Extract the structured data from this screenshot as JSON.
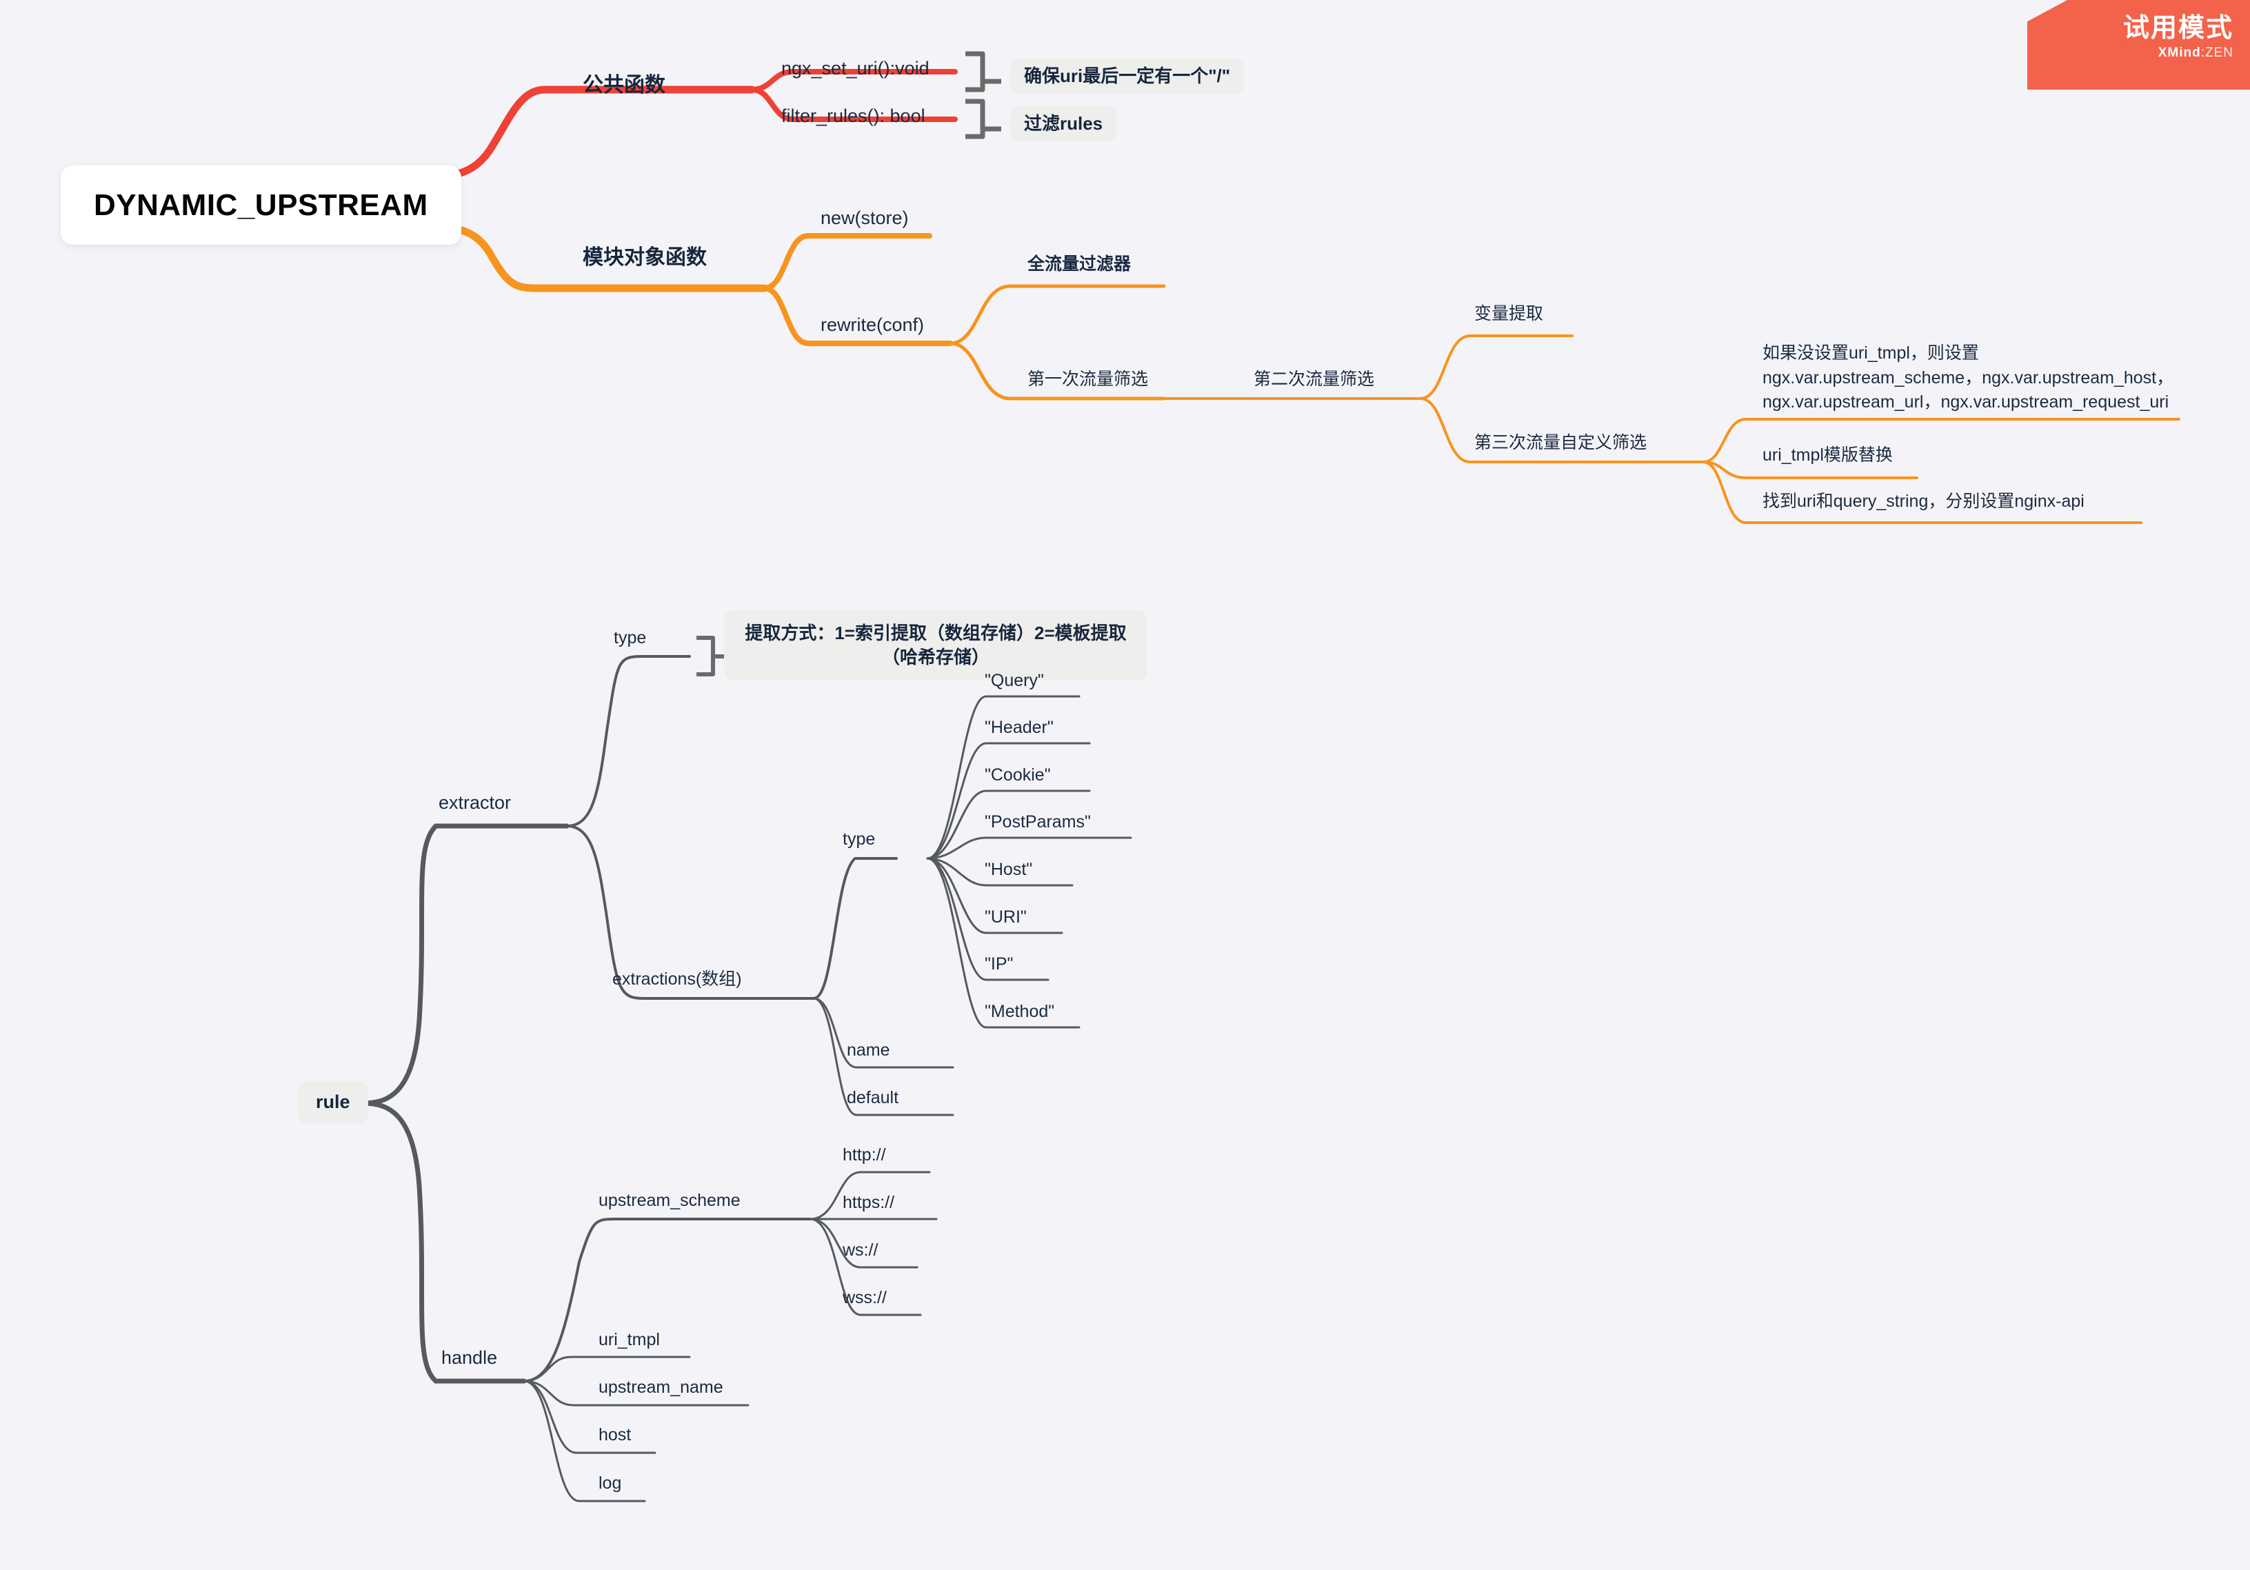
{
  "watermark": {
    "title": "试用模式",
    "brand_bold": "XMind",
    "brand_sep": ":",
    "brand_light": "ZEN"
  },
  "root": {
    "label": "DYNAMIC_UPSTREAM"
  },
  "branch_public": {
    "label": "公共函数",
    "children": [
      {
        "label": "ngx_set_uri():void",
        "note": "确保uri最后一定有一个\"/\""
      },
      {
        "label": "filter_rules(): bool",
        "note": "过滤rules"
      }
    ]
  },
  "branch_module": {
    "label": "模块对象函数",
    "new_store": "new(store)",
    "rewrite": "rewrite(conf)",
    "full_filter": "全流量过滤器",
    "pass1": "第一次流量筛选",
    "pass2": "第二次流量筛选",
    "var_extract": "变量提取",
    "pass3": "第三次流量自定义筛选",
    "pass3_children": [
      "如果没设置uri_tmpl，则设置ngx.var.upstream_scheme，ngx.var.upstream_host，ngx.var.upstream_url，ngx.var.upstream_request_uri",
      "uri_tmpl模版替换",
      "找到uri和query_string，分别设置nginx-api"
    ]
  },
  "rule": {
    "label": "rule",
    "extractor": {
      "label": "extractor",
      "type_label": "type",
      "type_note": "提取方式：1=索引提取（数组存储）2=模板提取（哈希存储）",
      "extractions_label": "extractions(数组)",
      "extraction_type_label": "type",
      "extraction_types": [
        "\"Query\"",
        "\"Header\"",
        "\"Cookie\"",
        "\"PostParams\"",
        "\"Host\"",
        "\"URI\"",
        "\"IP\"",
        "\"Method\""
      ],
      "name_label": "name",
      "default_label": "default"
    },
    "handle": {
      "label": "handle",
      "upstream_scheme_label": "upstream_scheme",
      "schemes": [
        "http://",
        "https://",
        "ws://",
        "wss://"
      ],
      "uri_tmpl_label": "uri_tmpl",
      "upstream_name_label": "upstream_name",
      "host_label": "host",
      "log_label": "log"
    }
  },
  "colors": {
    "background": "#f4f4f8",
    "red_branch": "#ef4136",
    "orange_branch": "#f7941e",
    "gray_branch": "#555a60",
    "text": "#1b2a41",
    "chip_bg": "#eeeeec",
    "watermark_bg": "#f3624a"
  }
}
